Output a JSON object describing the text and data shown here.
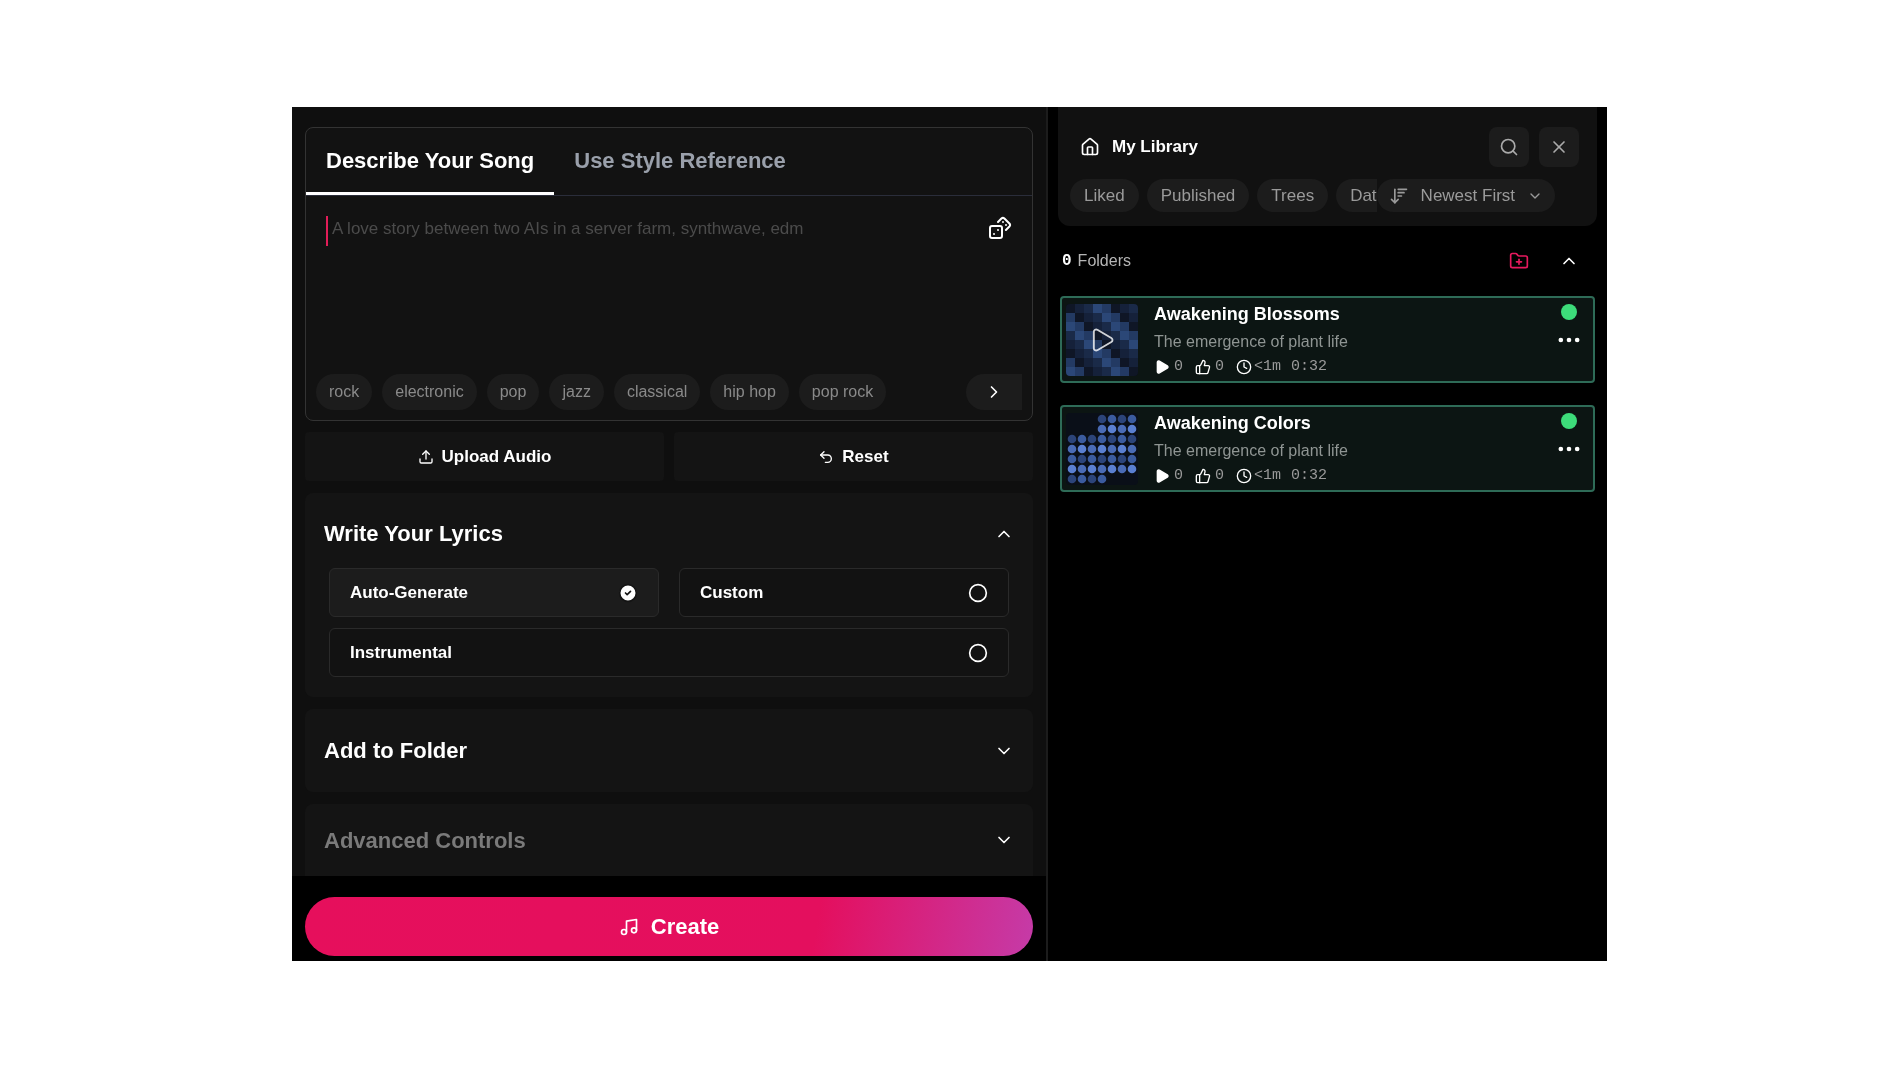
{
  "tabs": [
    {
      "label": "Describe Your Song",
      "selected": true
    },
    {
      "label": "Use Style Reference",
      "selected": false
    }
  ],
  "prompt": {
    "placeholder": "A love story between two AIs in a server farm, synthwave, edm"
  },
  "genre_tags": [
    "rock",
    "electronic",
    "pop",
    "jazz",
    "classical",
    "hip hop",
    "pop rock"
  ],
  "actions": [
    {
      "kind": "upload",
      "label": "Upload Audio"
    },
    {
      "kind": "reset",
      "label": "Reset"
    }
  ],
  "lyrics": {
    "title": "Write Your Lyrics",
    "expanded": true,
    "options": [
      {
        "label": "Auto-Generate",
        "selected": true,
        "wide": false
      },
      {
        "label": "Custom",
        "selected": false,
        "wide": false
      },
      {
        "label": "Instrumental",
        "selected": false,
        "wide": true
      }
    ]
  },
  "sections": [
    {
      "title": "Add to Folder",
      "expanded": false,
      "disabled": false
    },
    {
      "title": "Advanced Controls",
      "expanded": false,
      "disabled": true
    }
  ],
  "create_button": "Create",
  "library": {
    "title": "My Library",
    "filters": [
      "Liked",
      "Published",
      "Trees",
      "Dat"
    ],
    "sort": "Newest First",
    "folders": {
      "count": "0",
      "label": "Folders",
      "expanded": true
    },
    "songs": [
      {
        "title": "Awakening Blossoms",
        "description": "The emergence of plant life",
        "plays": "0",
        "likes": "0",
        "age": "<1m",
        "duration": "0:32",
        "kind": "blocks",
        "hovered": true,
        "color": "#3ddc7a"
      },
      {
        "title": "Awakening Colors",
        "description": "The emergence of plant life",
        "plays": "0",
        "likes": "0",
        "age": "<1m",
        "duration": "0:32",
        "kind": "dots",
        "hovered": false,
        "color": "#3ddc7a"
      }
    ]
  }
}
